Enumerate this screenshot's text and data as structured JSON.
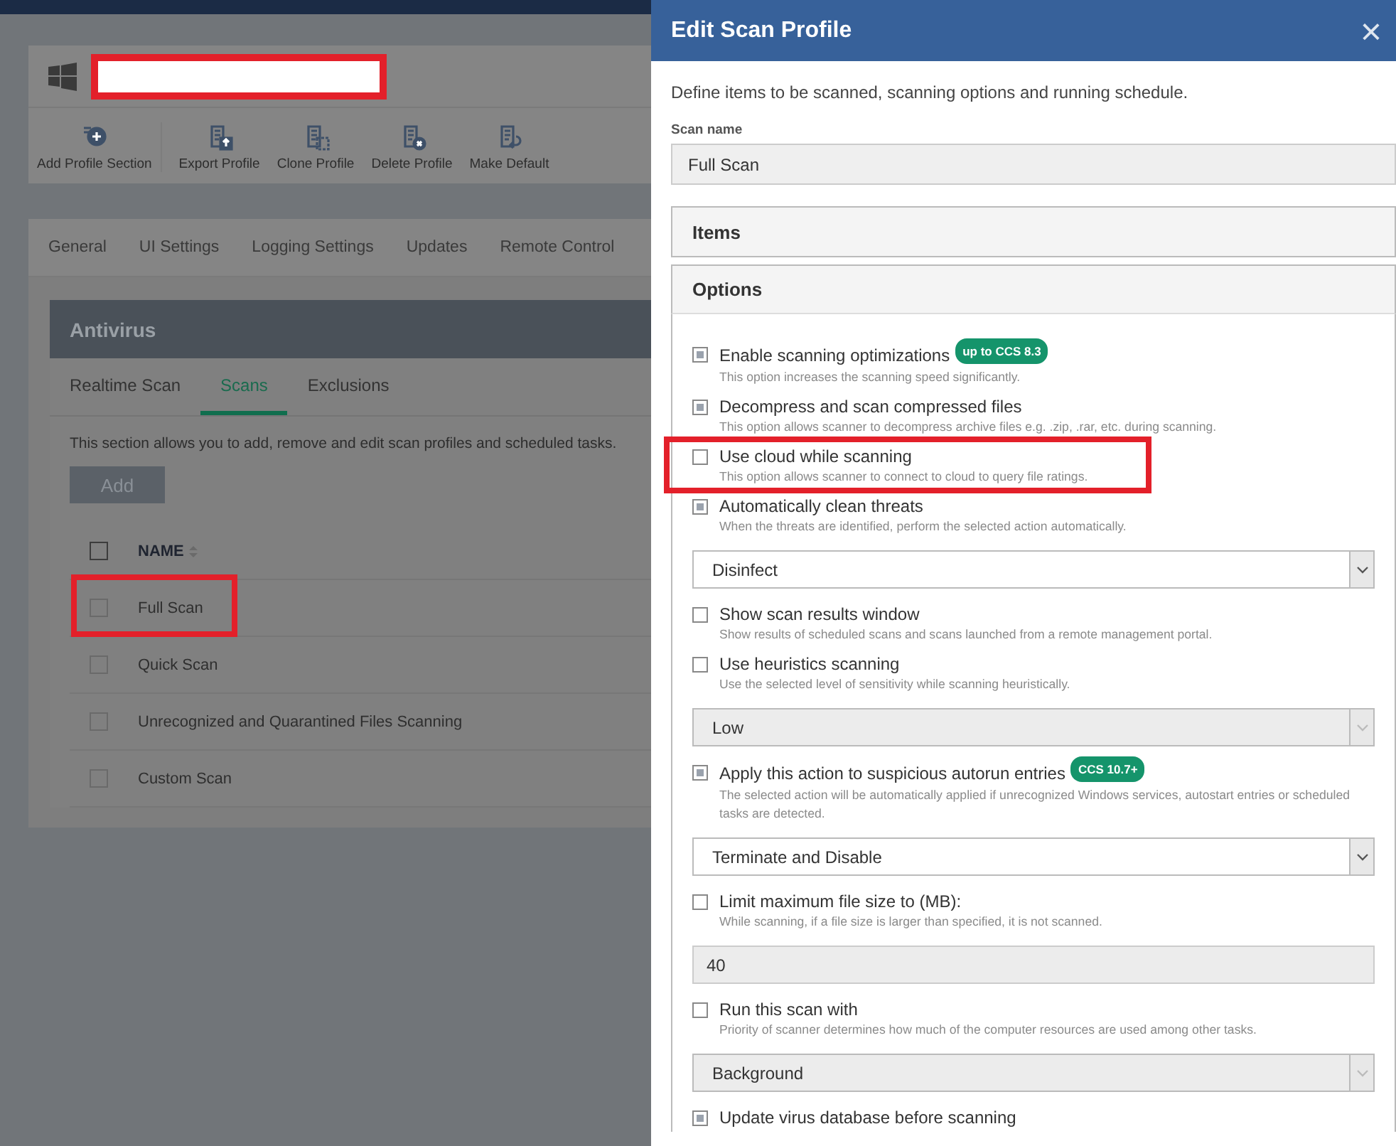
{
  "page": {
    "toolbar": [
      {
        "label": "Add Profile Section"
      },
      {
        "label": "Export Profile"
      },
      {
        "label": "Clone Profile"
      },
      {
        "label": "Delete Profile"
      },
      {
        "label": "Make Default"
      }
    ],
    "tabs": [
      {
        "label": "General",
        "selected": false
      },
      {
        "label": "UI Settings",
        "selected": false
      },
      {
        "label": "Logging Settings",
        "selected": false
      },
      {
        "label": "Updates",
        "selected": false
      },
      {
        "label": "Remote Control",
        "selected": false
      }
    ],
    "panel": {
      "title": "Antivirus",
      "subtabs": [
        {
          "label": "Realtime Scan",
          "selected": false
        },
        {
          "label": "Scans",
          "selected": true
        },
        {
          "label": "Exclusions",
          "selected": false
        }
      ],
      "description": "This section allows you to add, remove and edit scan profiles and scheduled tasks.",
      "add_button": "Add",
      "table": {
        "header": "NAME",
        "header_checked": false,
        "rows": [
          {
            "name": "Full Scan",
            "checked": false,
            "annotated": true
          },
          {
            "name": "Quick Scan",
            "checked": false,
            "annotated": false
          },
          {
            "name": "Unrecognized and Quarantined Files Scanning",
            "checked": false,
            "annotated": false
          },
          {
            "name": "Custom Scan",
            "checked": false,
            "annotated": false
          }
        ]
      }
    }
  },
  "dialog": {
    "title": "Edit Scan Profile",
    "close": "×",
    "intro": "Define items to be scanned, scanning options and running schedule.",
    "scan_name_label": "Scan name",
    "scan_name_value": "Full Scan",
    "sections": [
      {
        "title": "Items",
        "expanded": false
      },
      {
        "title": "Options",
        "expanded": true
      }
    ],
    "options": [
      {
        "kind": "checkbox",
        "label": "Enable scanning optimizations",
        "badge": "up to CCS 8.3",
        "checked": true,
        "annotated": false,
        "description": "This option increases the scanning speed significantly."
      },
      {
        "kind": "checkbox",
        "label": "Decompress and scan compressed files",
        "checked": true,
        "annotated": false,
        "description": "This option allows scanner to decompress archive files e.g. .zip, .rar, etc. during scanning."
      },
      {
        "kind": "checkbox",
        "label": "Use cloud while scanning",
        "checked": false,
        "annotated": true,
        "description": "This option allows scanner to connect to cloud to query file ratings."
      },
      {
        "kind": "checkbox",
        "label": "Automatically clean threats",
        "checked": true,
        "annotated": false,
        "description": "When the threats are identified, perform the selected action automatically."
      },
      {
        "kind": "select",
        "value": "Disinfect",
        "disabled": false
      },
      {
        "kind": "checkbox",
        "label": "Show scan results window",
        "checked": false,
        "annotated": false,
        "description": "Show results of scheduled scans and scans launched from a remote management portal."
      },
      {
        "kind": "checkbox",
        "label": "Use heuristics scanning",
        "checked": false,
        "annotated": false,
        "description": "Use the selected level of sensitivity while scanning heuristically."
      },
      {
        "kind": "select",
        "value": "Low",
        "disabled": true
      },
      {
        "kind": "checkbox",
        "label": "Apply this action to suspicious autorun entries",
        "badge": "CCS 10.7+",
        "checked": true,
        "annotated": false,
        "description": "The selected action will be automatically applied if unrecognized Windows services, autostart entries or scheduled tasks are detected."
      },
      {
        "kind": "select",
        "value": "Terminate and Disable",
        "disabled": false
      },
      {
        "kind": "checkbox",
        "label": "Limit maximum file size to (MB):",
        "checked": false,
        "annotated": false,
        "description": "While scanning, if a file size is larger than specified, it is not scanned."
      },
      {
        "kind": "input",
        "value": "40",
        "disabled": true
      },
      {
        "kind": "checkbox",
        "label": "Run this scan with",
        "checked": false,
        "annotated": false,
        "description": "Priority of scanner determines how much of the computer resources are used among other tasks."
      },
      {
        "kind": "select",
        "value": "Background",
        "disabled": true
      },
      {
        "kind": "checkbox",
        "label": "Update virus database before scanning",
        "checked": true,
        "annotated": false
      }
    ]
  }
}
